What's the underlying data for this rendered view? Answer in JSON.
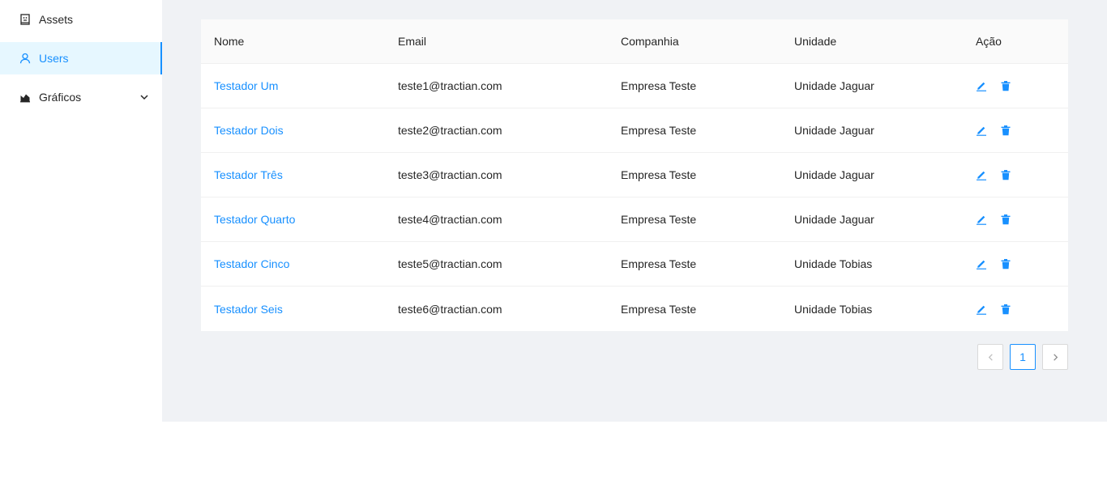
{
  "sidebar": {
    "items": [
      {
        "label": "Assets",
        "icon": "assets-icon"
      },
      {
        "label": "Users",
        "icon": "user-icon",
        "active": true
      },
      {
        "label": "Gráficos",
        "icon": "chart-icon",
        "expandable": true
      }
    ]
  },
  "table": {
    "headers": [
      "Nome",
      "Email",
      "Companhia",
      "Unidade",
      "Ação"
    ],
    "rows": [
      {
        "name": "Testador Um",
        "email": "teste1@tractian.com",
        "company": "Empresa Teste",
        "unit": "Unidade Jaguar"
      },
      {
        "name": "Testador Dois",
        "email": "teste2@tractian.com",
        "company": "Empresa Teste",
        "unit": "Unidade Jaguar"
      },
      {
        "name": "Testador Três",
        "email": "teste3@tractian.com",
        "company": "Empresa Teste",
        "unit": "Unidade Jaguar"
      },
      {
        "name": "Testador Quarto",
        "email": "teste4@tractian.com",
        "company": "Empresa Teste",
        "unit": "Unidade Jaguar"
      },
      {
        "name": "Testador Cinco",
        "email": "teste5@tractian.com",
        "company": "Empresa Teste",
        "unit": "Unidade Tobias"
      },
      {
        "name": "Testador Seis",
        "email": "teste6@tractian.com",
        "company": "Empresa Teste",
        "unit": "Unidade Tobias"
      }
    ]
  },
  "pagination": {
    "current": "1"
  },
  "colors": {
    "accent": "#1890ff",
    "content_bg": "#f0f2f5",
    "active_bg": "#e6f7ff"
  }
}
